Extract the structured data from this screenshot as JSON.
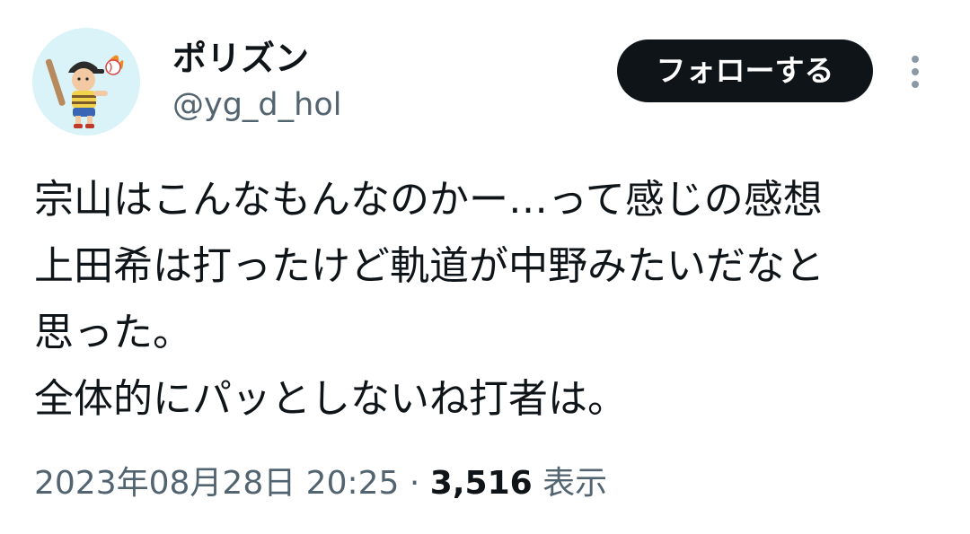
{
  "user": {
    "display_name": "ポリズン",
    "handle": "@yg_d_hol",
    "avatar_icon": "baseball-player-avatar"
  },
  "actions": {
    "follow_label": "フォローする",
    "more_icon": "more-vertical-icon"
  },
  "tweet": {
    "lines": [
      "宗山はこんなもんなのかー…って感じの感想",
      "上田希は打ったけど軌道が中野みたいだなと",
      "思った。",
      "全体的にパッとしないね打者は。"
    ]
  },
  "meta": {
    "timestamp": "2023年08月28日 20:25",
    "separator": "·",
    "views_count": "3,516",
    "views_label": "表示"
  },
  "colors": {
    "text_primary": "#0f1419",
    "text_secondary": "#536471",
    "button_bg": "#0f1419",
    "avatar_bg": "#d9f3f8"
  }
}
